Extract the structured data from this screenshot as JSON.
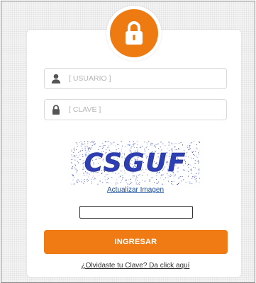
{
  "colors": {
    "accent": "#ee7b12",
    "button": "#f07a14",
    "link": "#1a4fa0",
    "captcha_text": "#2d3fb3"
  },
  "icons": {
    "badge": "lock-icon",
    "username": "user-icon",
    "password": "lock-icon"
  },
  "login": {
    "username_placeholder": "[ USUARIO ]",
    "password_placeholder": "[ CLAVE ]",
    "captcha_text": "CSGUF",
    "refresh_captcha_label": "Actualizar Imagen",
    "captcha_input_value": "",
    "submit_label": "INGRESAR",
    "forgot_label": "¿Olvidaste tu Clave? Da click aquí"
  }
}
